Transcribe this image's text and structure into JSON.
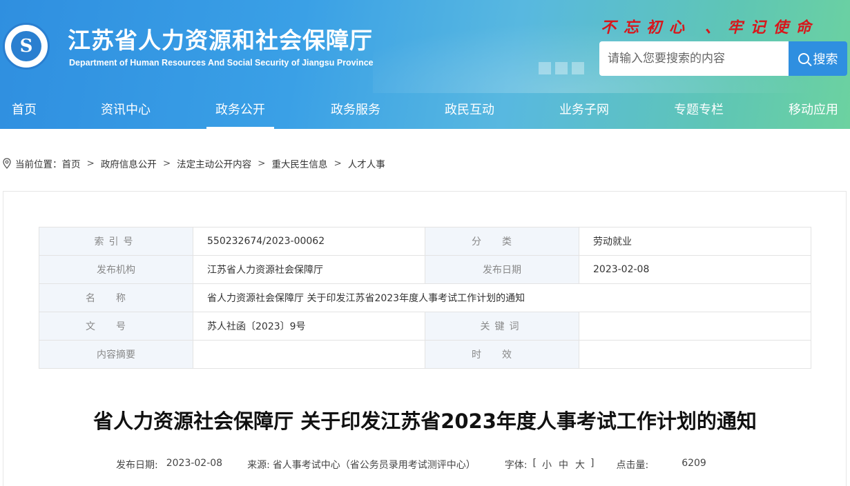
{
  "header": {
    "logo_text": "S",
    "site_title": "江苏省人力资源和社会保障厅",
    "site_subtitle": "Department of Human Resources And Social Security of Jiangsu Province",
    "slogan": "不忘初心 、牢记使命",
    "search_placeholder": "请输入您要搜索的内容",
    "search_button": "搜索"
  },
  "nav": {
    "items": [
      "首页",
      "资讯中心",
      "政务公开",
      "政务服务",
      "政民互动",
      "业务子网",
      "专题专栏",
      "移动应用"
    ],
    "active": "政务公开"
  },
  "breadcrumb": {
    "label": "当前位置：",
    "items": [
      "首页",
      "政府信息公开",
      "法定主动公开内容",
      "重大民生信息",
      "人才人事"
    ],
    "separator": ">"
  },
  "meta_table": {
    "index_label": "索引号",
    "index_value": "550232674/2023-00062",
    "category_label": "分类",
    "category_value": "劳动就业",
    "issuer_label": "发布机构",
    "issuer_value": "江苏省人力资源社会保障厅",
    "date_label": "发布日期",
    "date_value": "2023-02-08",
    "name_label": "名称",
    "name_value": "省人力资源社会保障厅 关于印发江苏省2023年度人事考试工作计划的通知",
    "docno_label": "文号",
    "docno_value": "苏人社函〔2023〕9号",
    "keywords_label": "关键词",
    "keywords_value": "",
    "summary_label": "内容摘要",
    "summary_value": "",
    "validity_label": "时效",
    "validity_value": ""
  },
  "document": {
    "title": "省人力资源社会保障厅 关于印发江苏省2023年度人事考试工作计划的通知",
    "date_label": "发布日期:",
    "date_value": "2023-02-08",
    "source_label": "来源:",
    "source_value": "省人事考试中心（省公务员录用考试测评中心）",
    "font_label": "字体:",
    "font_open": "[",
    "font_small": "小",
    "font_medium": "中",
    "font_large": "大",
    "font_close": "]",
    "hits_label": "点击量:",
    "hits_value": "6209"
  },
  "colors": {
    "header_start": "#2f8fe0",
    "header_end": "#6cd2a0",
    "slogan": "#d8161b",
    "label_bg": "#f2f6fb"
  }
}
